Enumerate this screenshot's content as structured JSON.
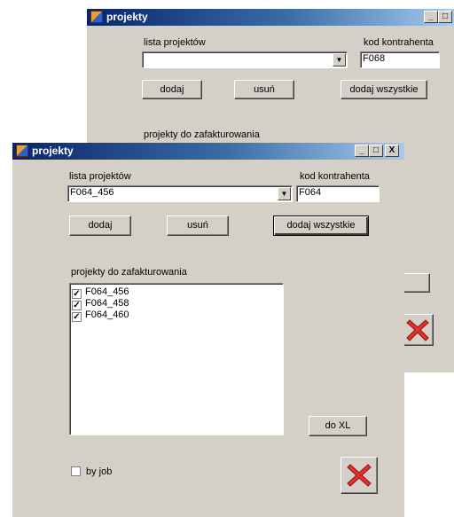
{
  "back_window": {
    "title": "projekty",
    "lista_label": "lista projektów",
    "kod_label": "kod kontrahenta",
    "kod_value": "F068",
    "combo_value": "",
    "add_label": "dodaj",
    "remove_label": "usuń",
    "add_all_label": "dodaj wszystkie",
    "projects_label": "projekty do zafakturowania",
    "caption_min": "_",
    "caption_max": "□",
    "caption_close": "X"
  },
  "front_window": {
    "title": "projekty",
    "lista_label": "lista projektów",
    "combo_value": "F064_456",
    "kod_label": "kod kontrahenta",
    "kod_value": "F064",
    "add_label": "dodaj",
    "remove_label": "usuń",
    "add_all_label": "dodaj wszystkie",
    "projects_label": "projekty do zafakturowania",
    "projects": [
      {
        "label": "F064_456",
        "checked": true
      },
      {
        "label": "F064_458",
        "checked": true
      },
      {
        "label": "F064_460",
        "checked": true
      }
    ],
    "export_label": "do XL",
    "by_job_label": "by job",
    "by_job_checked": false,
    "caption_min": "_",
    "caption_max": "□",
    "caption_close": "X"
  },
  "icons": {
    "close": "red-x-icon",
    "app": "app-window-icon"
  },
  "colors": {
    "title_start": "#0a246a",
    "title_end": "#a6caf0",
    "face": "#d4d0c8",
    "close_red": "#e03030"
  }
}
